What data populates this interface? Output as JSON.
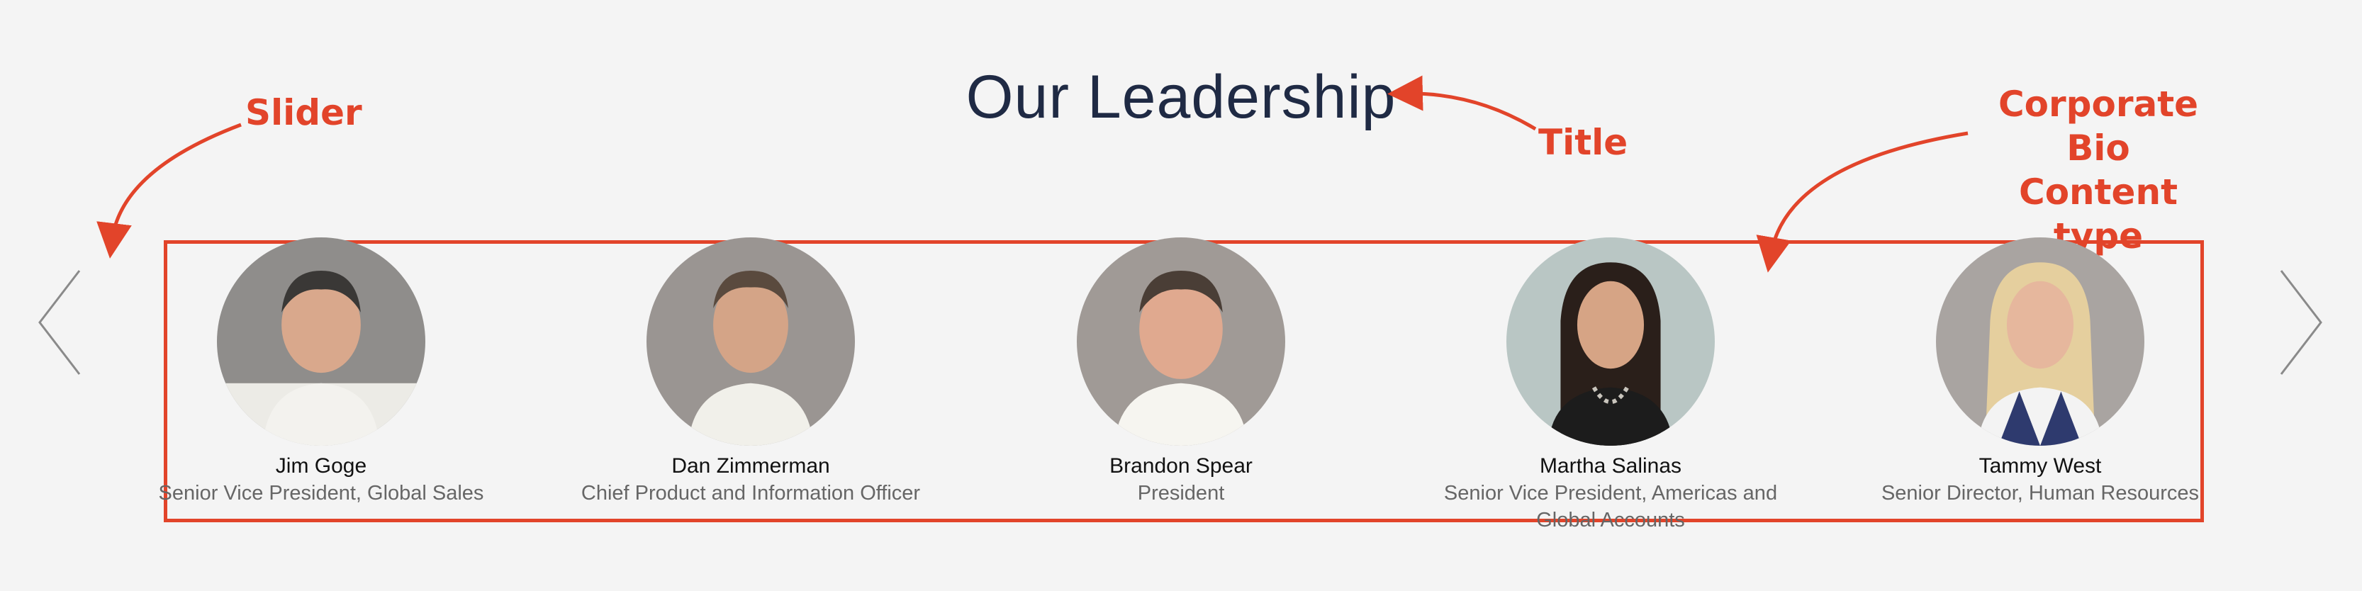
{
  "page_title": "Our Leadership",
  "annotations": {
    "slider": "Slider",
    "title": "Title",
    "bio_line1": "Corporate Bio",
    "bio_line2": "Content type"
  },
  "colors": {
    "accent": "#e2442a",
    "title": "#1f2a44",
    "background": "#f4f4f4"
  },
  "slider": {
    "prev_icon": "chevron-left-icon",
    "next_icon": "chevron-right-icon"
  },
  "leaders": [
    {
      "name": "Jim Goge",
      "role": "Senior Vice President, Global Sales"
    },
    {
      "name": "Dan Zimmerman",
      "role": "Chief Product and Information Officer"
    },
    {
      "name": "Brandon Spear",
      "role": "President"
    },
    {
      "name": "Martha Salinas",
      "role": "Senior Vice President, Americas and Global Accounts"
    },
    {
      "name": "Tammy West",
      "role": "Senior Director, Human Resources"
    }
  ]
}
